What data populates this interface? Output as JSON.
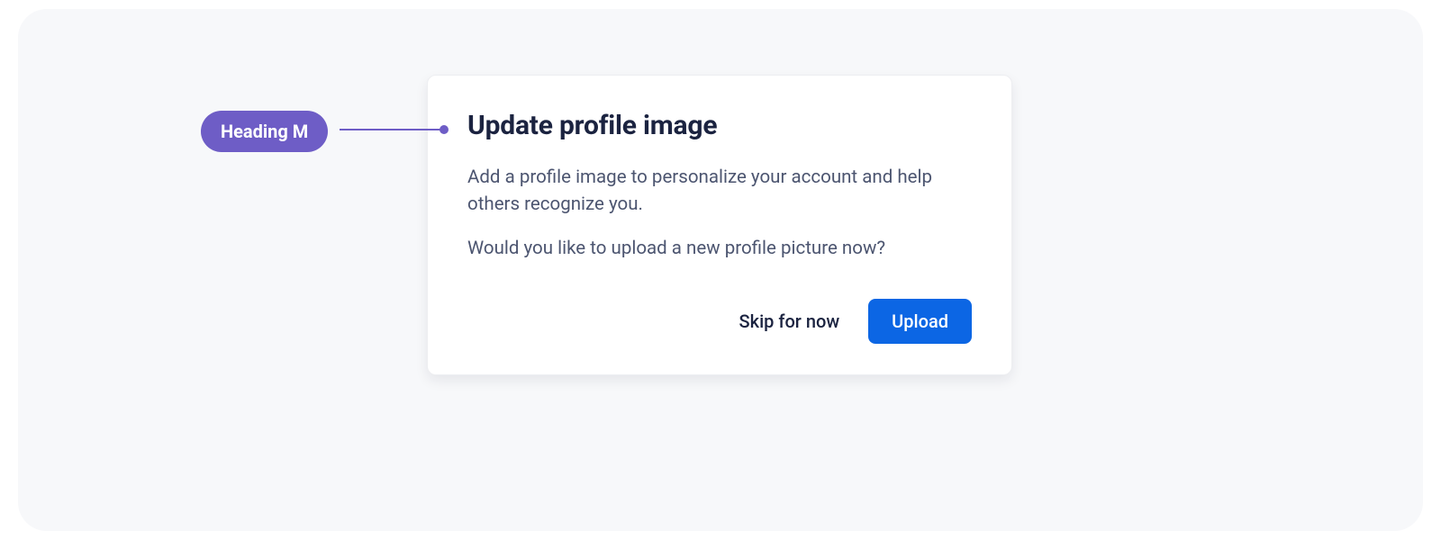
{
  "annotation": {
    "label": "Heading M"
  },
  "dialog": {
    "title": "Update profile image",
    "body_p1": "Add a profile image to personalize your account and help others recognize you.",
    "body_p2": "Would you like to upload a new profile picture now?",
    "actions": {
      "skip_label": "Skip for now",
      "upload_label": "Upload"
    }
  }
}
